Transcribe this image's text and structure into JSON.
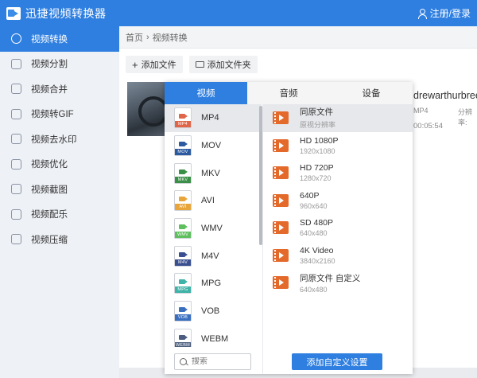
{
  "app": {
    "title": "迅捷视频转换器",
    "login": "注册/登录"
  },
  "sidebar": {
    "items": [
      {
        "label": "视频转换",
        "active": true
      },
      {
        "label": "视频分割"
      },
      {
        "label": "视频合并"
      },
      {
        "label": "视频转GIF"
      },
      {
        "label": "视频去水印"
      },
      {
        "label": "视频优化"
      },
      {
        "label": "视频截图"
      },
      {
        "label": "视频配乐"
      },
      {
        "label": "视频压缩"
      }
    ]
  },
  "breadcrumb": {
    "home": "首页",
    "sep": "›",
    "current": "视频转换"
  },
  "toolbar": {
    "add_file": "添加文件",
    "add_folder": "添加文件夹",
    "plus": "+"
  },
  "file": {
    "name": "drewarthurbree...",
    "format": "MP4",
    "resolution": "分辨率:",
    "duration": "00:05:54"
  },
  "popup": {
    "tabs": [
      {
        "label": "视频",
        "active": true
      },
      {
        "label": "音频"
      },
      {
        "label": "设备"
      }
    ],
    "formats": [
      {
        "label": "MP4",
        "color": "#e0664a",
        "active": true
      },
      {
        "label": "MOV",
        "color": "#2c5aa0"
      },
      {
        "label": "MKV",
        "color": "#3a8f47"
      },
      {
        "label": "AVI",
        "color": "#e8a53a"
      },
      {
        "label": "WMV",
        "color": "#5fbf5f"
      },
      {
        "label": "M4V",
        "color": "#3a4f8f"
      },
      {
        "label": "MPG",
        "color": "#3fb3a8"
      },
      {
        "label": "VOB",
        "color": "#3a6fc0"
      },
      {
        "label": "WEBM",
        "color": "#4a5d7e"
      }
    ],
    "presets": [
      {
        "name": "同原文件",
        "sub": "原视分辨率",
        "active": true
      },
      {
        "name": "HD 1080P",
        "sub": "1920x1080"
      },
      {
        "name": "HD 720P",
        "sub": "1280x720"
      },
      {
        "name": "640P",
        "sub": "960x640"
      },
      {
        "name": "SD 480P",
        "sub": "640x480"
      },
      {
        "name": "4K Video",
        "sub": "3840x2160"
      },
      {
        "name": "同原文件 自定义",
        "sub": "640x480"
      }
    ],
    "search_placeholder": "搜索",
    "custom_button": "添加自定义设置"
  }
}
